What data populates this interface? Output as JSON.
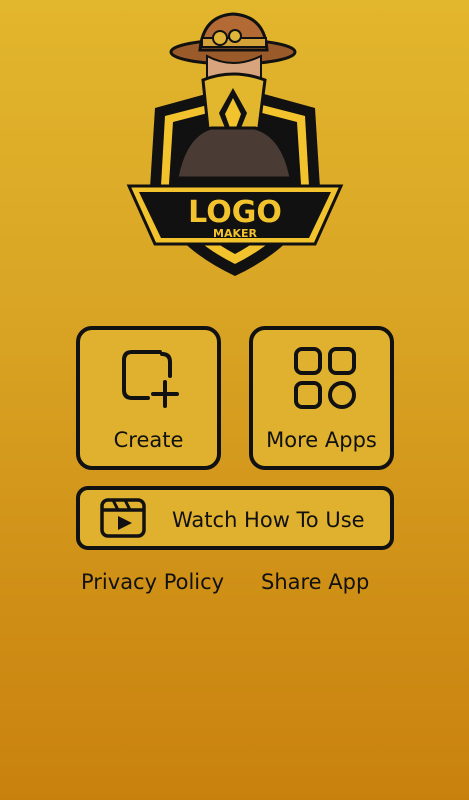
{
  "logo": {
    "title": "LOGO",
    "subtitle": "MAKER"
  },
  "actions": {
    "create_label": "Create",
    "more_apps_label": "More Apps",
    "watch_label": "Watch How To Use"
  },
  "links": {
    "privacy_label": "Privacy Policy",
    "share_label": "Share App"
  },
  "icons": {
    "create": "add-square-icon",
    "more_apps": "apps-grid-icon",
    "watch": "video-clip-icon"
  },
  "colors": {
    "background_top": "#e2b62d",
    "background_bottom": "#c9810e",
    "outline": "#111111",
    "accent": "#f2c32c"
  }
}
